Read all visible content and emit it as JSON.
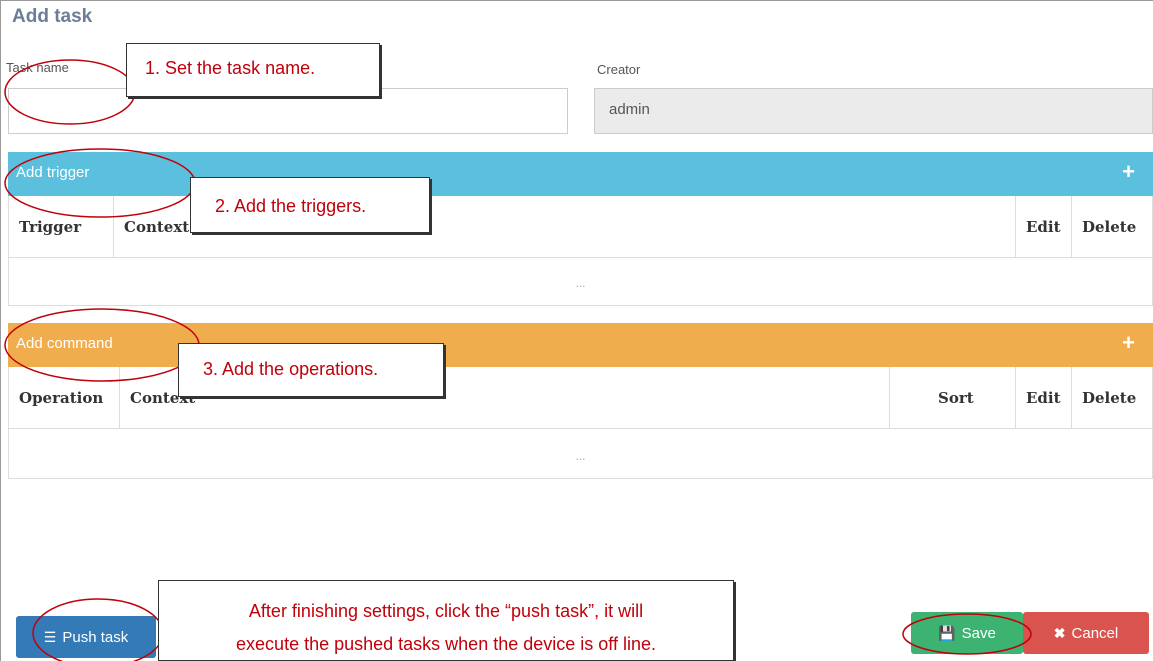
{
  "page": {
    "title": "Add task"
  },
  "form": {
    "task_name_label": "Task name",
    "task_name_value": "",
    "creator_label": "Creator",
    "creator_value": "admin"
  },
  "trigger_section": {
    "bar_label": "Add trigger",
    "columns": [
      "Trigger",
      "Context",
      "Edit",
      "Delete"
    ],
    "empty_text": "..."
  },
  "command_section": {
    "bar_label": "Add command",
    "columns": [
      "Operation",
      "Context",
      "Sort",
      "Edit",
      "Delete"
    ],
    "empty_text": "..."
  },
  "buttons": {
    "push_task": "Push task",
    "save": "Save",
    "cancel": "Cancel"
  },
  "callouts": {
    "step1": "1. Set the task name.",
    "step2": "2. Add the triggers.",
    "step3": "3. Add the operations.",
    "step4_line1": "After finishing settings, click the “push task”, it will",
    "step4_line2": "execute the pushed tasks when the device is off line."
  },
  "colors": {
    "trigger_bar": "#5bc0de",
    "command_bar": "#f0ad4e",
    "push_button": "#337ab7",
    "save_button": "#3cb371",
    "cancel_button": "#d9534f",
    "annotation": "#c0000a"
  },
  "icons": {
    "add_trigger": "plus-icon",
    "add_command": "plus-icon",
    "push": "list-icon",
    "save": "floppy-disk-icon",
    "cancel": "close-icon"
  }
}
